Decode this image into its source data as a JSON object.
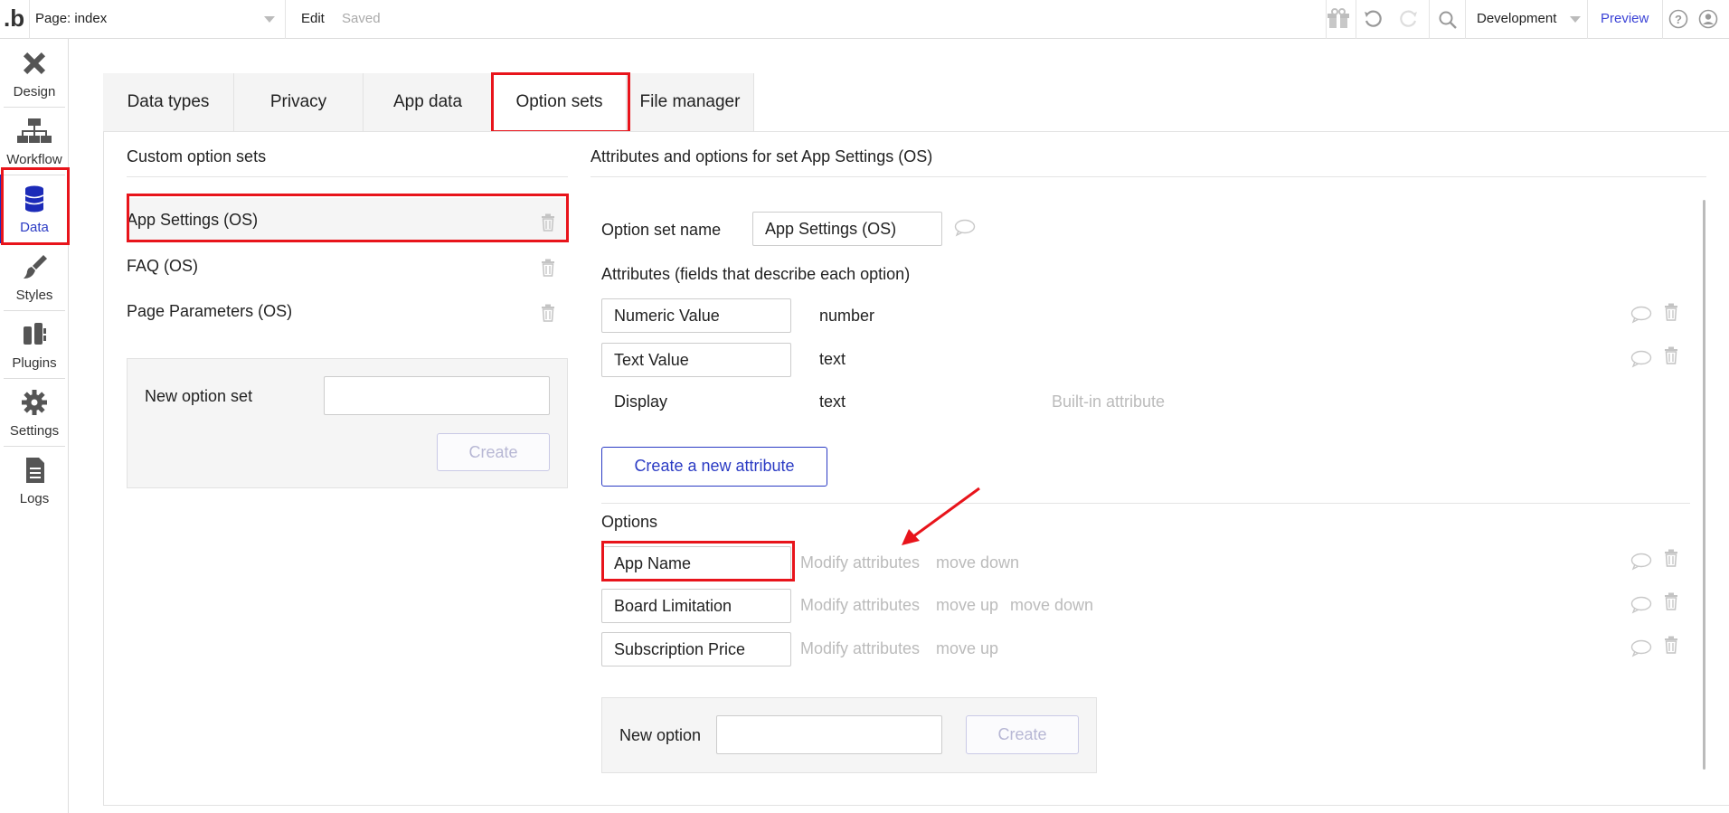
{
  "topbar": {
    "logo": ".b",
    "page_label": "Page: index",
    "edit_label": "Edit",
    "saved_label": "Saved",
    "environment": "Development",
    "preview_label": "Preview"
  },
  "sidebar": {
    "items": [
      {
        "label": "Design",
        "icon": "design-icon"
      },
      {
        "label": "Workflow",
        "icon": "workflow-icon"
      },
      {
        "label": "Data",
        "icon": "database-icon"
      },
      {
        "label": "Styles",
        "icon": "brush-icon"
      },
      {
        "label": "Plugins",
        "icon": "plug-icon"
      },
      {
        "label": "Settings",
        "icon": "gear-icon"
      },
      {
        "label": "Logs",
        "icon": "document-icon"
      }
    ],
    "active_index": 2
  },
  "tabs": [
    {
      "label": "Data types"
    },
    {
      "label": "Privacy"
    },
    {
      "label": "App data"
    },
    {
      "label": "Option sets"
    },
    {
      "label": "File manager"
    }
  ],
  "left_panel": {
    "title": "Custom option sets",
    "option_sets": [
      {
        "name": "App Settings (OS)"
      },
      {
        "name": "FAQ (OS)"
      },
      {
        "name": "Page Parameters (OS)"
      }
    ],
    "new_option_set_label": "New option set",
    "new_option_set_value": "",
    "create_label": "Create"
  },
  "right_panel": {
    "title": "Attributes and options for set App Settings (OS)",
    "set_name_label": "Option set name",
    "set_name_value": "App Settings (OS)",
    "attributes_label": "Attributes (fields that describe each option)",
    "attributes": [
      {
        "name": "Numeric Value",
        "type": "number"
      },
      {
        "name": "Text Value",
        "type": "text"
      },
      {
        "name": "Display",
        "type": "text",
        "note": "Built-in attribute"
      }
    ],
    "create_attribute_label": "Create a new attribute",
    "options_label": "Options",
    "modify_label": "Modify attributes",
    "move_up_label": "move up",
    "move_down_label": "move down",
    "options": [
      {
        "name": "App Name"
      },
      {
        "name": "Board Limitation"
      },
      {
        "name": "Subscription Price"
      }
    ],
    "new_option_label": "New option",
    "new_option_value": "",
    "create_label": "Create"
  },
  "colors": {
    "accent": "#2b3bc4",
    "highlight": "#e8141b",
    "preview": "#3b43d6"
  }
}
